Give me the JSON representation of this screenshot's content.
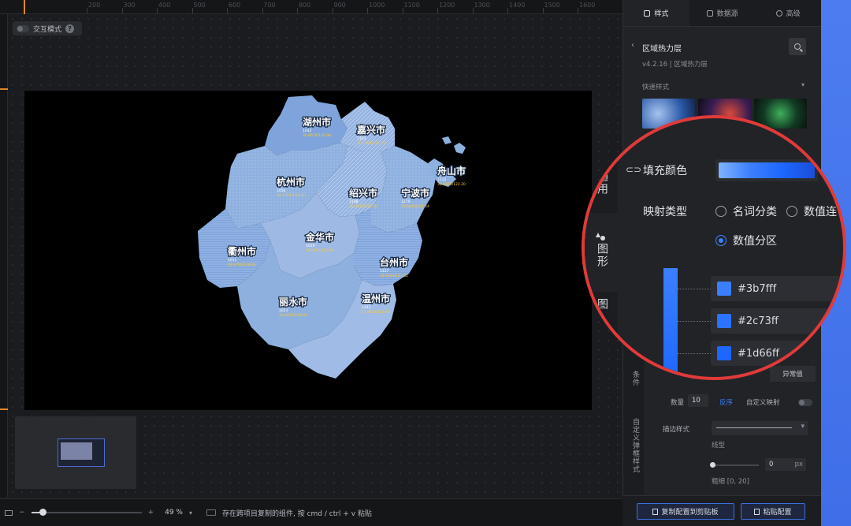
{
  "ruler": {
    "ticks": [
      "200",
      "300",
      "400",
      "500",
      "600",
      "700",
      "800",
      "900",
      "1000",
      "1100",
      "1200",
      "1300",
      "1400",
      "1500",
      "1600"
    ]
  },
  "canvas": {
    "interaction_mode_label": "交互模式",
    "help_glyph": "?"
  },
  "map": {
    "cities": [
      {
        "name": "湖州市",
        "sub": "1042",
        "val": "30.8674/120.08"
      },
      {
        "name": "嘉兴市",
        "sub": "1163",
        "val": "30.7465/120.75"
      },
      {
        "name": "杭州市",
        "sub": "1054",
        "val": "30.2741/120.15"
      },
      {
        "name": "绍兴市",
        "sub": "1108",
        "val": "30.0023/120.58"
      },
      {
        "name": "宁波市",
        "sub": "1179",
        "val": "29.8683/121.54"
      },
      {
        "name": "舟山市",
        "sub": "1132",
        "val": "30.0160/122.20"
      },
      {
        "name": "金华市",
        "sub": "1019",
        "val": "29.0791/119.64"
      },
      {
        "name": "衢州市",
        "sub": "1011",
        "val": "28.9700/118.86"
      },
      {
        "name": "台州市",
        "sub": "1127",
        "val": "28.6564/121.42"
      },
      {
        "name": "丽水市",
        "sub": "1023",
        "val": "28.4676/119.92"
      },
      {
        "name": "温州市",
        "sub": "1141",
        "val": "27.9938/120.69"
      }
    ]
  },
  "bottom_bar": {
    "minus": "−",
    "plus": "+",
    "zoom_value": "49 %",
    "zoom_level": 0.1,
    "zoom_caret": "▾",
    "paste_hint": "存在跨项目复制的组件, 按 cmd / ctrl + v 粘贴"
  },
  "panel": {
    "tabs": [
      {
        "label": "样式",
        "active": true
      },
      {
        "label": "数据源",
        "active": false
      },
      {
        "label": "高级",
        "active": false
      }
    ],
    "component": {
      "title": "区域热力层",
      "version": "v4.2.16 | 区域热力层"
    },
    "quick_style_label": "快速样式",
    "side_tabs": [
      "通用",
      "图形",
      "图例",
      "条件",
      "自定义弹框样式"
    ],
    "lens": {
      "fill_color_label": "填充颜色",
      "mapping_type_label": "映射类型",
      "options": [
        "名词分类",
        "数值连",
        "数值分区"
      ],
      "side_labels": [
        "通用",
        "图形",
        "图"
      ],
      "colors": [
        {
          "hex": "#3b7fff",
          "label": "#3b7fff"
        },
        {
          "hex": "#2c73ff",
          "label": "#2c73ff"
        },
        {
          "hex": "#1d66ff",
          "label": "#1d66ff"
        }
      ]
    },
    "lower": {
      "abnormal_value": "异常值",
      "count_label": "数量",
      "count_value": "10",
      "reverse_label": "反序",
      "custom_map_label": "自定义映射",
      "stroke_style_label": "描边样式",
      "line_type_label": "线型",
      "width_value": "0",
      "width_unit": "px",
      "width_range_label": "粗细 [0, 20]"
    },
    "footer": {
      "copy_button": "复制配置到剪贴板",
      "paste_button": "粘贴配置"
    }
  },
  "colors": {
    "accent": "#3b7fff",
    "lens_border": "#e03a3a",
    "map_base": "#8eb0df"
  }
}
